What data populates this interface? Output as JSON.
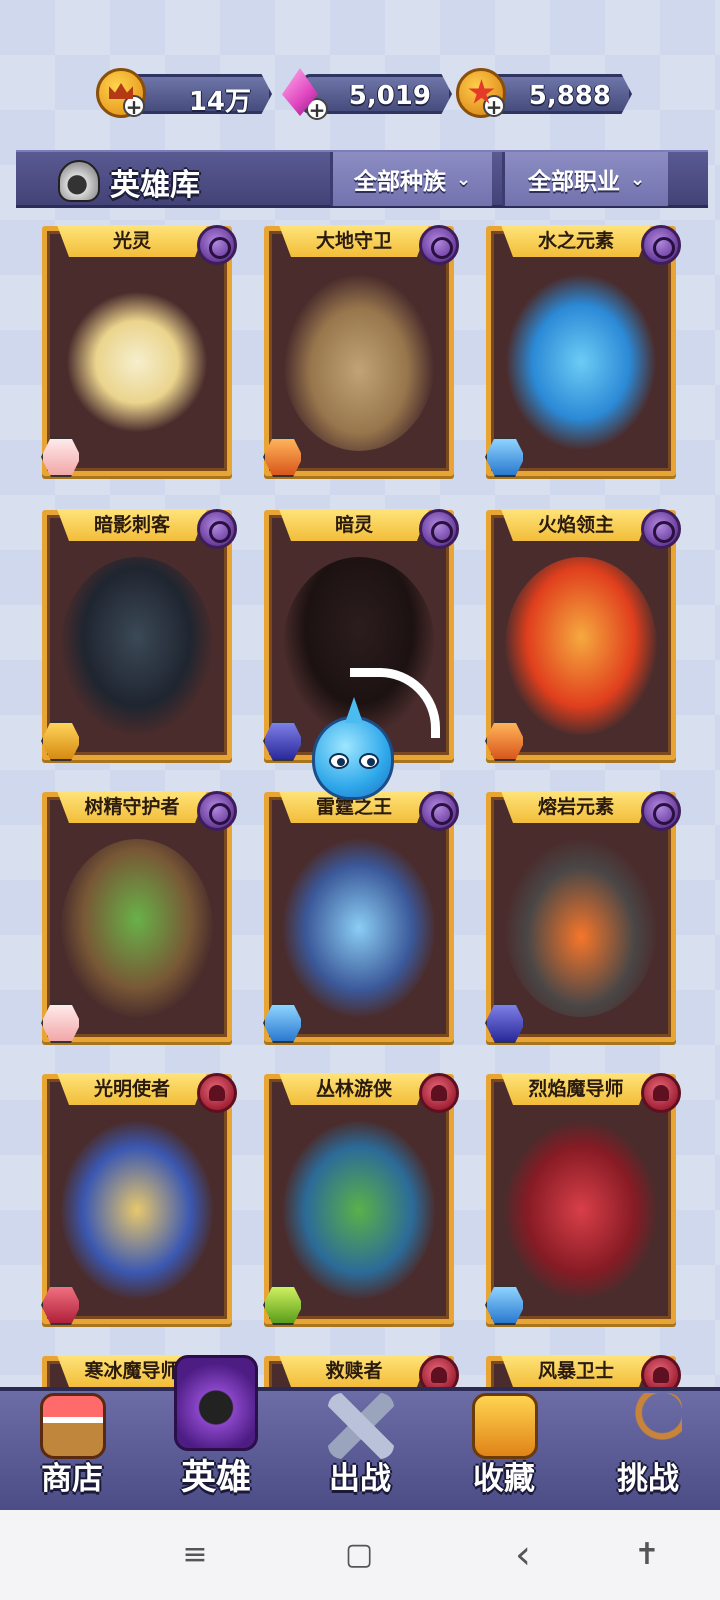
{
  "currency": {
    "gold": {
      "icon": "crown-coin-icon",
      "value": "14万"
    },
    "gems": {
      "icon": "pink-gem-icon",
      "value": "5,019"
    },
    "stars": {
      "icon": "star-coin-icon",
      "value": "5,888"
    }
  },
  "header": {
    "icon": "helmet-icon",
    "title": "英雄库",
    "filter_race": "全部种族",
    "filter_class": "全部职业"
  },
  "heroes": [
    {
      "name": "光灵",
      "race": "elemental",
      "class_color": "white"
    },
    {
      "name": "大地守卫",
      "race": "elemental",
      "class_color": "orange"
    },
    {
      "name": "水之元素",
      "race": "elemental",
      "class_color": "blue"
    },
    {
      "name": "暗影刺客",
      "race": "elemental",
      "class_color": "gold"
    },
    {
      "name": "暗灵",
      "race": "elemental",
      "class_color": "navy"
    },
    {
      "name": "火焰领主",
      "race": "elemental",
      "class_color": "orange"
    },
    {
      "name": "树精守护者",
      "race": "elemental",
      "class_color": "white"
    },
    {
      "name": "雷霆之王",
      "race": "elemental",
      "class_color": "blue"
    },
    {
      "name": "熔岩元素",
      "race": "elemental",
      "class_color": "navy"
    },
    {
      "name": "光明使者",
      "race": "human",
      "class_color": "red"
    },
    {
      "name": "丛林游侠",
      "race": "human",
      "class_color": "green"
    },
    {
      "name": "烈焰魔导师",
      "race": "human",
      "class_color": "blue"
    },
    {
      "name": "寒冰魔导师",
      "race": "human",
      "class_color": "white"
    },
    {
      "name": "救赎者",
      "race": "human",
      "class_color": "white"
    },
    {
      "name": "风暴卫士",
      "race": "human",
      "class_color": "white"
    }
  ],
  "bottom_nav": [
    {
      "label": "商店",
      "icon": "shop-icon",
      "active": false
    },
    {
      "label": "英雄",
      "icon": "hero-helmet-icon",
      "active": true
    },
    {
      "label": "出战",
      "icon": "crossed-swords-icon",
      "active": false
    },
    {
      "label": "收藏",
      "icon": "treasure-chest-icon",
      "active": false
    },
    {
      "label": "挑战",
      "icon": "crossbow-icon",
      "active": false
    }
  ],
  "system_nav": {
    "menu": "≡",
    "home": "▢",
    "back": "‹",
    "accessibility": "✝"
  },
  "colors": {
    "card_border": "#e9a533",
    "card_bg": "#4a2c2c",
    "header_bg": "#4e4e86",
    "nav_bg": "#5c5c96"
  }
}
